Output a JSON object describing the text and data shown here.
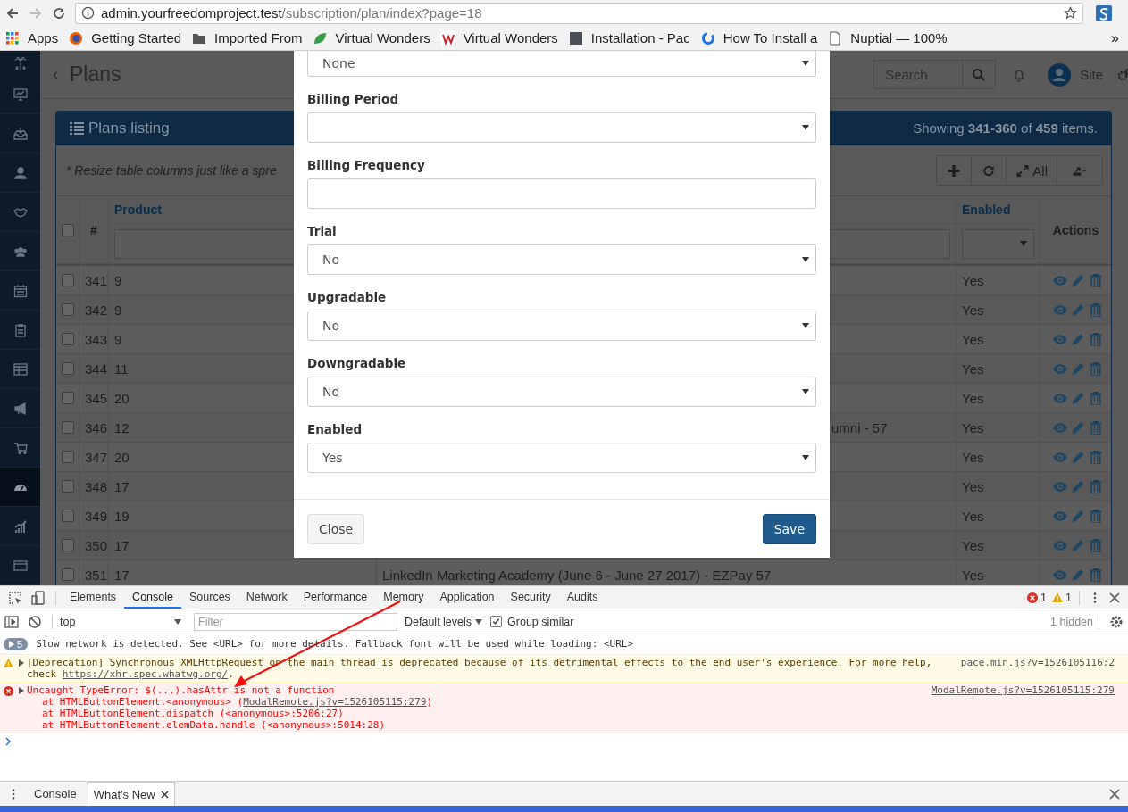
{
  "browser": {
    "address_host": "admin.yourfreedomproject.test",
    "address_path": "/subscription/plan/index?page=18",
    "more": "»",
    "bookmarks": [
      {
        "label": "Apps"
      },
      {
        "label": "Getting Started"
      },
      {
        "label": "Imported From"
      },
      {
        "label": "Virtual Wonders"
      },
      {
        "label": "Virtual Wonders"
      },
      {
        "label": "Installation - Pac"
      },
      {
        "label": "How To Install a"
      },
      {
        "label": "Nuptial — 100%"
      }
    ]
  },
  "sidebar": {
    "items": [
      {
        "selected": false
      },
      {
        "selected": false
      },
      {
        "selected": false
      },
      {
        "selected": false
      },
      {
        "selected": false
      },
      {
        "selected": false
      },
      {
        "selected": false
      },
      {
        "selected": false
      },
      {
        "selected": false
      },
      {
        "selected": false
      },
      {
        "selected": true
      },
      {
        "selected": false
      },
      {
        "selected": false
      }
    ]
  },
  "header": {
    "back": "‹",
    "title": "Plans",
    "search": {
      "placeholder": "Search"
    },
    "user": "Site"
  },
  "panel": {
    "title": "Plans listing",
    "summary": "Showing **341-360** of **459** items.",
    "note": "* Resize table columns just like a spre",
    "all_label": "All"
  },
  "table": {
    "select_all": {
      "checked": false
    },
    "columns": [
      {
        "label": "#"
      },
      {
        "label": "Product"
      },
      {
        "label": "Enabled"
      },
      {
        "label": "Actions"
      }
    ],
    "rows": [
      {
        "checked": false,
        "num": "341",
        "product": "9",
        "enabled": "Yes"
      },
      {
        "checked": false,
        "num": "342",
        "product": "9",
        "enabled": "Yes"
      },
      {
        "checked": false,
        "num": "343",
        "product": "9",
        "enabled": "Yes"
      },
      {
        "checked": false,
        "num": "344",
        "product": "11",
        "enabled": "Yes"
      },
      {
        "checked": false,
        "num": "345",
        "product": "20",
        "enabled": "Yes"
      },
      {
        "checked": false,
        "num": "346",
        "product": "12",
        "column_3": "umni - 57",
        "enabled": "Yes"
      },
      {
        "checked": false,
        "num": "347",
        "product": "20",
        "enabled": "Yes"
      },
      {
        "checked": false,
        "num": "348",
        "product": "17",
        "enabled": "Yes"
      },
      {
        "checked": false,
        "num": "349",
        "product": "19",
        "enabled": "Yes"
      },
      {
        "checked": false,
        "num": "350",
        "product": "17",
        "enabled": "Yes"
      },
      {
        "checked": false,
        "num": "351",
        "product": "17",
        "column_3": "LinkedIn Marketing Academy (June 6 - June 27 2017) - EZPay 57",
        "enabled": "Yes"
      }
    ]
  },
  "modal": {
    "fields": [
      {
        "kind": "select",
        "value": "None"
      },
      {
        "kind": "select",
        "label": "Billing Period"
      },
      {
        "kind": "input",
        "label": "Billing Frequency"
      },
      {
        "kind": "select",
        "label": "Trial",
        "value": "No"
      },
      {
        "kind": "select",
        "label": "Upgradable",
        "value": "No"
      },
      {
        "kind": "select",
        "label": "Downgradable",
        "value": "No"
      },
      {
        "kind": "select",
        "label": "Enabled",
        "value": "Yes"
      }
    ],
    "buttons": [
      {
        "kind": "default",
        "label": "Close"
      },
      {
        "kind": "primary",
        "label": "Save"
      }
    ]
  },
  "devtools": {
    "tabs": [
      {
        "label": "Elements",
        "selected": false
      },
      {
        "label": "Console",
        "selected": true
      },
      {
        "label": "Sources",
        "selected": false
      },
      {
        "label": "Network",
        "selected": false
      },
      {
        "label": "Performance",
        "selected": false
      },
      {
        "label": "Memory",
        "selected": false
      },
      {
        "label": "Application",
        "selected": false
      },
      {
        "label": "Security",
        "selected": false
      },
      {
        "label": "Audits",
        "selected": false
      }
    ],
    "errors": "1",
    "warnings": "1",
    "context": "top",
    "filter": {
      "placeholder": "Filter"
    },
    "levels": "Default levels",
    "group_similar": {
      "label": "Group similar",
      "checked": true
    },
    "hidden": "1 hidden",
    "messages": [
      {
        "kind": "info",
        "count": "5",
        "text": "Slow network is detected. See <URL> for more details. Fallback font will be used while loading: <URL>"
      },
      {
        "kind": "warning",
        "text": "[Deprecation] Synchronous XMLHttpRequest on the main thread is deprecated because of its detrimental effects to the end user's experience. For more help, check",
        "link": "https://xhr.spec.whatwg.org/",
        "after": ".",
        "source": "pace.min.js?v=1526105116:2"
      },
      {
        "kind": "error",
        "text": "Uncaught TypeError: $(...).hasAttr is not a function",
        "source": "ModalRemote.js?v=1526105115:279",
        "stack": [
          {
            "text": "at HTMLButtonElement.<anonymous> (",
            "link": "ModalRemote.js?v=1526105115:279",
            "after": ")"
          },
          {
            "text": "at HTMLButtonElement.dispatch (<anonymous>:5206:27)"
          },
          {
            "text": "at HTMLButtonElement.elemData.handle (<anonymous>:5014:28)"
          }
        ]
      }
    ],
    "drawer_tabs": [
      {
        "label": "Console",
        "selected": false
      },
      {
        "label": "What's New",
        "selected": true
      }
    ]
  }
}
